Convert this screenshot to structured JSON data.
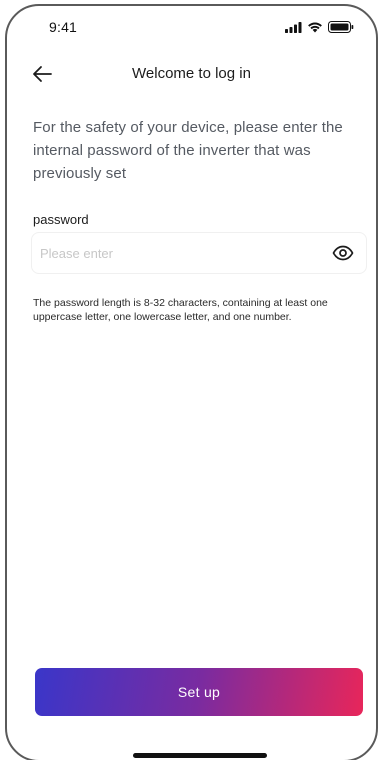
{
  "status_bar": {
    "time": "9:41",
    "icons": [
      "cellular-signal-icon",
      "wifi-icon",
      "battery-icon"
    ]
  },
  "nav": {
    "back_icon": "arrow-left-icon",
    "title": "Welcome to log in"
  },
  "intro": {
    "text": "For the safety of your device, please enter the internal password of the inverter that was previously set"
  },
  "password": {
    "label": "password",
    "placeholder": "Please enter",
    "value": "",
    "visibility_icon": "eye-icon"
  },
  "hint": {
    "text": "The password length is 8-32 characters, containing at least one uppercase letter, one lowercase letter, and one number."
  },
  "setup_button": {
    "label": "Set up",
    "gradient_colors": [
      "#3a36c9",
      "#7a2ba0",
      "#e8265a"
    ]
  }
}
